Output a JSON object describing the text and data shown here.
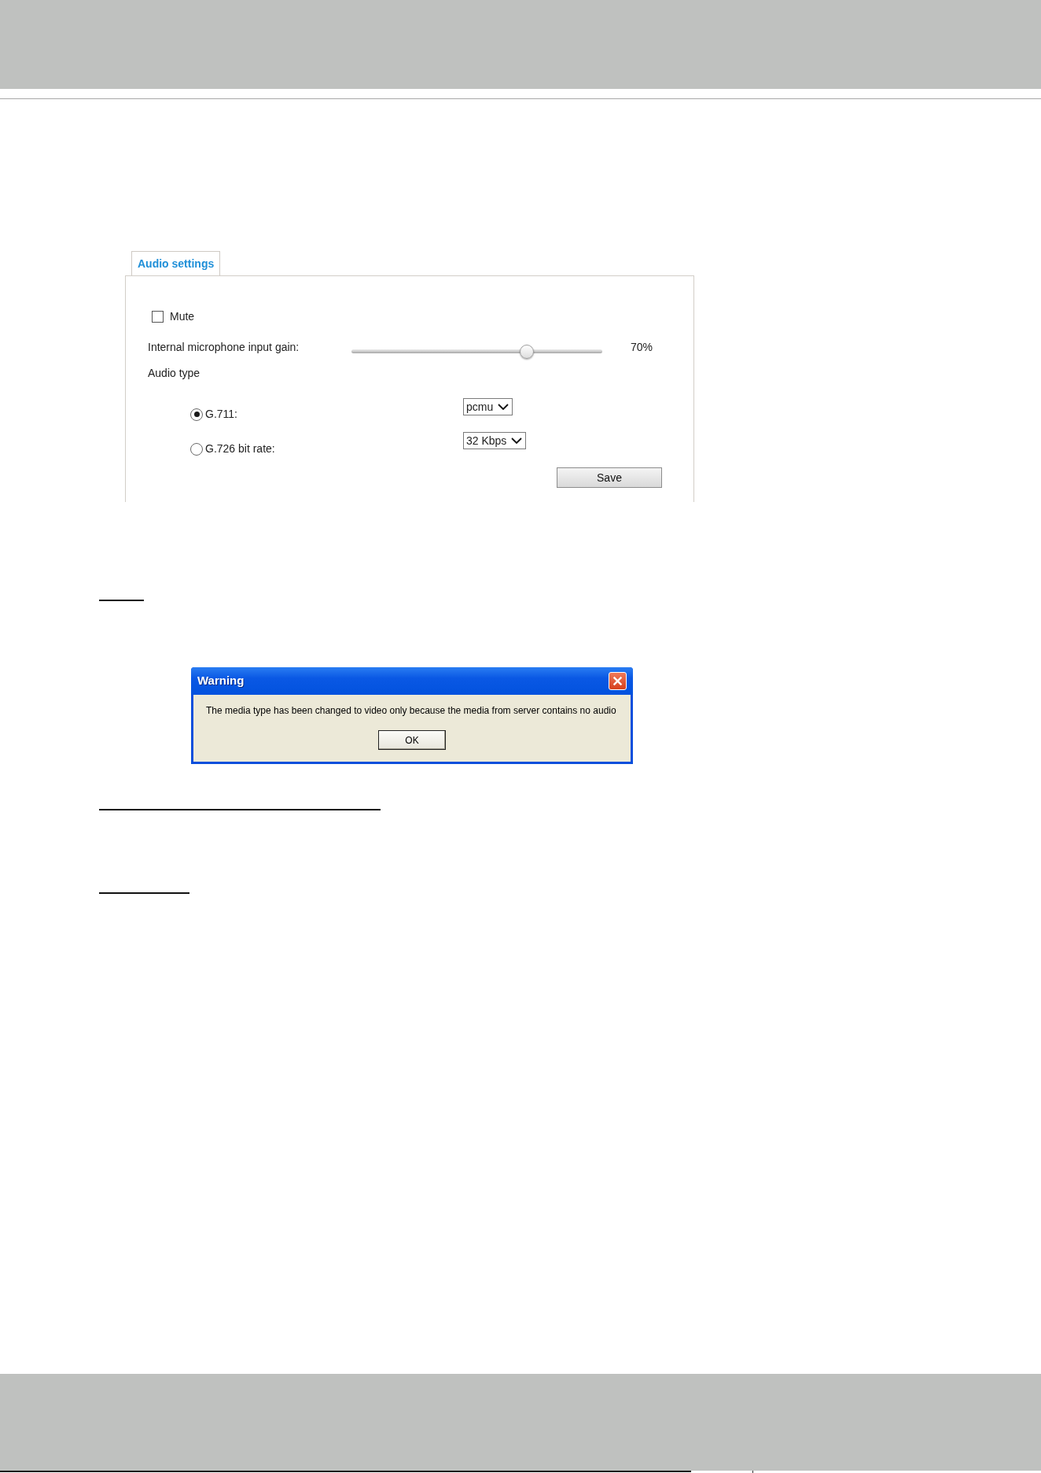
{
  "tab": {
    "label": "Audio settings",
    "selected": true
  },
  "mute": {
    "label": "Mute",
    "checked": false
  },
  "gain": {
    "label": "Internal microphone input gain:",
    "level": 0.7,
    "reading": "70%"
  },
  "audio_type": {
    "label": "Audio type",
    "options": [
      {
        "label": "G.711:",
        "selected": true,
        "select_value": "pcmu"
      },
      {
        "label": "G.726 bit rate:",
        "selected": false,
        "select_value": "32 Kbps"
      }
    ]
  },
  "save_button": {
    "label": "Save"
  },
  "warning_dialog": {
    "title": "Warning",
    "message": "The media type has been changed to video only because the media from server contains no audio",
    "button": "OK"
  }
}
